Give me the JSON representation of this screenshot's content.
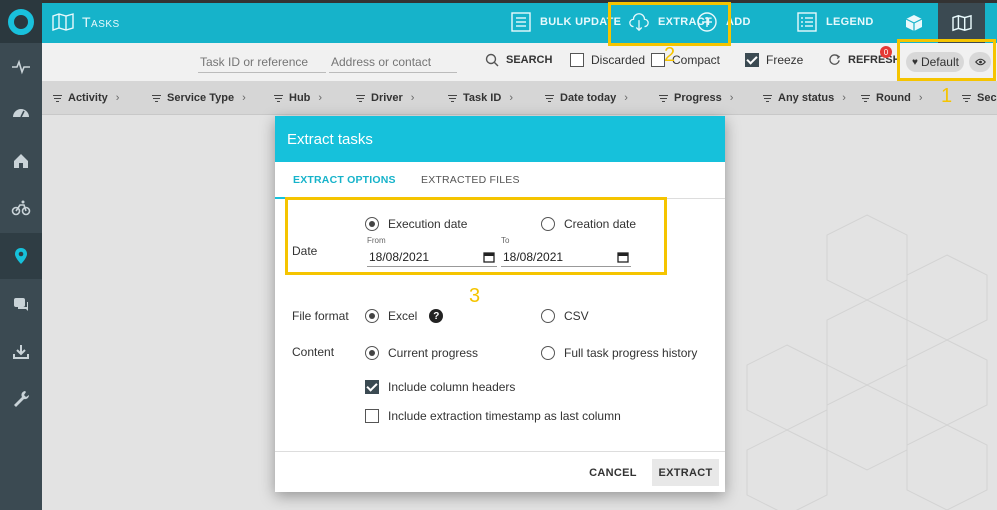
{
  "header": {
    "title": "Tasks",
    "bulk_update": "BULK UPDATE",
    "extract": "EXTRACT",
    "add": "ADD",
    "legend": "LEGEND"
  },
  "filterbar": {
    "task_placeholder": "Task ID or reference",
    "address_placeholder": "Address or contact",
    "search": "SEARCH",
    "discarded": "Discarded",
    "compact": "Compact",
    "freeze": "Freeze",
    "refresh": "REFRESH",
    "badge": "0",
    "default": "Default"
  },
  "columns": [
    "Activity",
    "Service Type",
    "Hub",
    "Driver",
    "Task ID",
    "Date today",
    "Progress",
    "Any status",
    "Round",
    "Sec"
  ],
  "dialog": {
    "title": "Extract tasks",
    "tabs": [
      "EXTRACT OPTIONS",
      "EXTRACTED FILES"
    ],
    "date_label": "Date",
    "execution_date": "Execution date",
    "creation_date": "Creation date",
    "from_label": "From",
    "to_label": "To",
    "from_value": "18/08/2021",
    "to_value": "18/08/2021",
    "file_format_label": "File format",
    "excel": "Excel",
    "help": "?",
    "csv": "CSV",
    "content_label": "Content",
    "current_progress": "Current progress",
    "full_history": "Full task progress history",
    "include_headers": "Include column headers",
    "include_timestamp": "Include extraction timestamp as last column",
    "cancel": "CANCEL",
    "extract": "EXTRACT"
  },
  "annotations": {
    "one": "1",
    "two": "2",
    "three": "3"
  },
  "colors": {
    "accent": "#16c1db",
    "annotation": "#f5c400",
    "sidebar": "#3b4a52"
  }
}
